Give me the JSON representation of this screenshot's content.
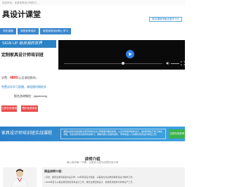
{
  "header": {
    "welcome_text": "欢迎来到，优星家具设计网官方…",
    "logo_text": "具设计课堂",
    "login_button": "报名课程领取优惠学习卡"
  },
  "nav": {
    "tabs": [
      {
        "label": "同步直播"
      },
      {
        "label": "家居家具培训"
      },
      {
        "label": "家居家具培训网上学习"
      }
    ]
  },
  "signup": {
    "form_label_main": "SIGN UP",
    "form_label_sub": "给自我的世界",
    "title": "定制家具设计师培训班",
    "price_prefix": "学费：",
    "price_value": "4800",
    "price_suffix": "元(含课程教材)",
    "promo_text": "免费试学学习直播，课程随时随地学",
    "contact_text": "报名咨询微信：jiajudesing",
    "consult_button": "立即在线咨询",
    "enroll_button": "预约免费体验"
  },
  "banner": {
    "title": "家具设计师培训班实战课程",
    "description": "课程总结和系统讲解全屋定制家具设计师需要掌握的技能，从空间测量到柜体设计、板材拆单生产加工等全流程，包含完整项目案例实操练习，课程内容从基础到进阶，带你快速入门并胜任家具设计岗位工作。",
    "button": "立即在线咨询"
  },
  "intro": {
    "title": "讲师介绍",
    "subtitle": "用心讲好每一节课，让更多人成为优秀的设计师"
  },
  "instructor": {
    "heading": "同志讲师介绍：",
    "lines": [
      "• 同志，国家注册高级室内设计师，10年家具设计经验，从事室内及全屋定制家具设计教学工作…",
      "• 2008年至今从事全屋定制及家具设计工作，擅长全屋定制设计、柜类家具结构与拆单生产工艺…"
    ]
  },
  "colors": {
    "primary_blue": "#2b82c4",
    "accent_red": "#e84c4c",
    "cta_green": "#3ab34a",
    "play_blue": "#2f7fe8"
  },
  "video": {
    "progress_percent": 60
  }
}
